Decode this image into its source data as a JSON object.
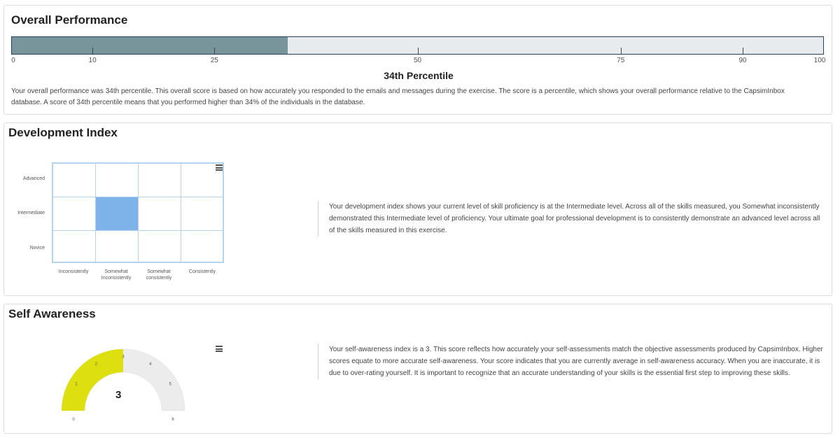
{
  "overall": {
    "title": "Overall Performance",
    "percentile_value": 34,
    "ticks": [
      "0",
      "10",
      "25",
      "50",
      "75",
      "90",
      "100"
    ],
    "percentile_label": "34th Percentile",
    "description": "Your overall performance was 34th percentile. This overall score is based on how accurately you responded to the emails and messages during the exercise. The score is a percentile, which shows your overall performance relative to the CapsimInbox database. A score of 34th percentile means that you performed higher than 34% of the individuals in the database.",
    "colors": {
      "fill": "#78959b",
      "track": "#e8ebee",
      "border": "#27405a"
    }
  },
  "development": {
    "title": "Development Index",
    "rows": [
      "Advanced",
      "Intermediate",
      "Novice"
    ],
    "columns": [
      "Inconsistently",
      "Somewhat Inconsistently",
      "Somewhat consistently",
      "Consistently"
    ],
    "selected": {
      "row": "Intermediate",
      "column": "Somewhat Inconsistently"
    },
    "highlight_color": "#7db3e8",
    "menu_icon": "hamburger-menu-icon",
    "description": "Your development index shows your current level of skill proficiency is at the Intermediate level. Across all of the skills measured, you Somewhat inconsistently demonstrated this Intermediate level of proficiency. Your ultimate goal for professional development is to consistently demonstrate an advanced level across all of the skills measured in this exercise."
  },
  "self_awareness": {
    "title": "Self Awareness",
    "value": 3,
    "value_label": "3",
    "scale_labels": [
      "0",
      "1",
      "2",
      "3",
      "4",
      "5",
      "6"
    ],
    "scale_max": 6,
    "colors": {
      "fill": "#dde00e",
      "track": "#ececec"
    },
    "menu_icon": "hamburger-menu-icon",
    "description": "Your self-awareness index is a 3. This score reflects how accurately your self-assessments match the objective assessments produced by CapsimInbox. Higher scores equate to more accurate self-awareness. Your score indicates that you are currently average in self-awareness accuracy. When you are inaccurate, it is due to over-rating yourself. It is important to recognize that an accurate understanding of your skills is the essential first step to improving these skills."
  }
}
